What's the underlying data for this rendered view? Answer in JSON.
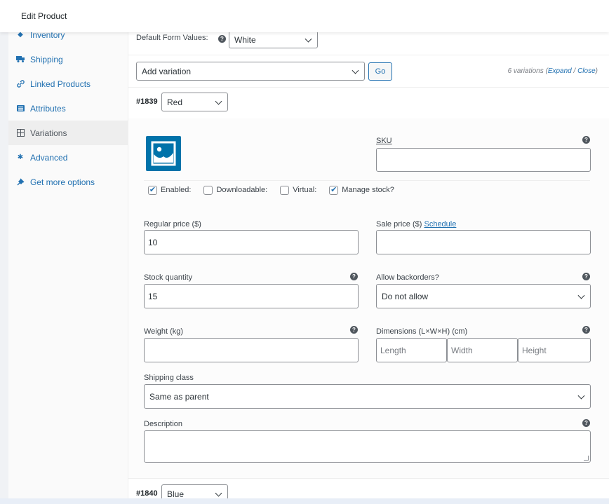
{
  "header": {
    "title": "Edit Product"
  },
  "sidebar": {
    "items": [
      {
        "label": "Inventory",
        "icon": "diamond-icon"
      },
      {
        "label": "Shipping",
        "icon": "truck-icon"
      },
      {
        "label": "Linked Products",
        "icon": "link-icon"
      },
      {
        "label": "Attributes",
        "icon": "list-icon"
      },
      {
        "label": "Variations",
        "icon": "grid-icon"
      },
      {
        "label": "Advanced",
        "icon": "gear-icon"
      },
      {
        "label": "Get more options",
        "icon": "plug-icon"
      }
    ],
    "active": "Variations"
  },
  "toolbar": {
    "default_form_label": "Default Form Values:",
    "default_form_value": "White",
    "add_variation_value": "Add variation",
    "go_label": "Go",
    "variations_count": "6 variations",
    "expand_label": "Expand",
    "close_label": "Close"
  },
  "variation1": {
    "id": "#1839",
    "color": "Red",
    "sku_label": "SKU",
    "sku_value": "",
    "enabled_label": "Enabled:",
    "downloadable_label": "Downloadable:",
    "virtual_label": "Virtual:",
    "manage_stock_label": "Manage stock?",
    "enabled": true,
    "downloadable": false,
    "virtual": false,
    "manage_stock": true,
    "regular_price_label": "Regular price ($)",
    "regular_price": "10",
    "sale_price_label": "Sale price ($)",
    "schedule_label": "Schedule",
    "sale_price": "",
    "stock_qty_label": "Stock quantity",
    "stock_qty": "15",
    "backorders_label": "Allow backorders?",
    "backorders_value": "Do not allow",
    "weight_label": "Weight (kg)",
    "weight": "",
    "dimensions_label": "Dimensions (L×W×H) (cm)",
    "length_placeholder": "Length",
    "width_placeholder": "Width",
    "height_placeholder": "Height",
    "shipping_class_label": "Shipping class",
    "shipping_class_value": "Same as parent",
    "description_label": "Description",
    "description": ""
  },
  "variation2": {
    "id": "#1840",
    "color": "Blue"
  },
  "colors": {
    "accent": "#2271b1",
    "image": "#0073aa"
  }
}
